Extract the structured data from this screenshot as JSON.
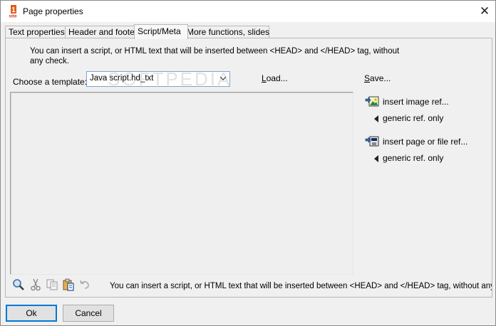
{
  "window": {
    "title": "Page properties",
    "app_icon_text": "site"
  },
  "tabs": [
    {
      "label": "Text properties",
      "active": false
    },
    {
      "label": "Header and footer",
      "active": false
    },
    {
      "label": "Script/Meta",
      "active": true
    },
    {
      "label": "More functions, slides",
      "active": false
    }
  ],
  "script_meta": {
    "info_text": "You can insert a script, or HTML text that will be inserted between <HEAD> and </HEAD> tag, without any check.",
    "template_label": "Choose a template:",
    "template_value": "Java script.hd_txt",
    "load_label": "Load...",
    "save_label": "Save...",
    "editor_content": "",
    "insert_image_label": "insert image ref...",
    "insert_image_generic": "generic ref. only",
    "insert_page_label": "insert page or file ref...",
    "insert_page_generic": "generic ref. only",
    "status_text": "You can insert a script, or HTML text that will be inserted between <HEAD> and </HEAD> tag, without any check."
  },
  "toolbar": {
    "icons": [
      "search-icon",
      "cut-icon",
      "copy-icon",
      "paste-icon",
      "undo-icon"
    ]
  },
  "buttons": {
    "ok_label": "Ok",
    "cancel_label": "Cancel"
  },
  "watermark_text": "SOFTPEDIA",
  "colors": {
    "accent": "#0078d7",
    "select_border": "#7aa6d8"
  }
}
